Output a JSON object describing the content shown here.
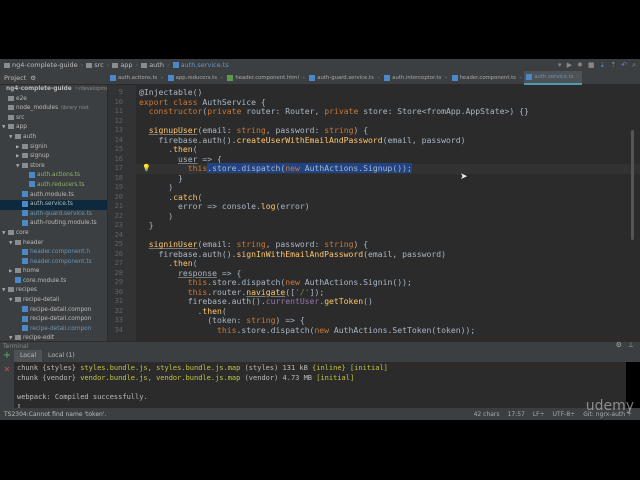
{
  "breadcrumb": [
    "ng4-complete-guide",
    "src",
    "app",
    "auth",
    "auth.service.ts"
  ],
  "project_bar": {
    "label": "Project"
  },
  "tabs": [
    {
      "label": "auth.actions.ts",
      "icon": "ts-file-icon",
      "active": false
    },
    {
      "label": "app.reducers.ts",
      "icon": "ts-file-icon",
      "active": false
    },
    {
      "label": "header.component.html",
      "icon": "html-file-icon",
      "active": false
    },
    {
      "label": "auth-guard.service.ts",
      "icon": "ts-file-icon",
      "active": false
    },
    {
      "label": "auth.interceptor.ts",
      "icon": "ts-file-icon",
      "active": false
    },
    {
      "label": "header.component.ts",
      "icon": "ts-file-icon",
      "active": false
    },
    {
      "label": "auth.service.ts",
      "icon": "ts-file-icon",
      "active": true
    }
  ],
  "tree": [
    {
      "label": "ng4-complete-guide",
      "extra": "~/developmen",
      "level": 0,
      "arrow": "",
      "kind": "root"
    },
    {
      "label": "e2e",
      "level": 0,
      "arrow": "",
      "kind": "folder"
    },
    {
      "label": "node_modules",
      "extra": "library root",
      "level": 0,
      "arrow": "",
      "kind": "folder"
    },
    {
      "label": "src",
      "level": 0,
      "arrow": "",
      "kind": "folder"
    },
    {
      "label": "app",
      "level": 0,
      "arrow": "▼",
      "kind": "folder"
    },
    {
      "label": "auth",
      "level": 1,
      "arrow": "▼",
      "kind": "folder"
    },
    {
      "label": "signin",
      "level": 2,
      "arrow": "▶",
      "kind": "folder"
    },
    {
      "label": "signup",
      "level": 2,
      "arrow": "▶",
      "kind": "folder"
    },
    {
      "label": "store",
      "level": 2,
      "arrow": "▼",
      "kind": "folder"
    },
    {
      "label": "auth.actions.ts",
      "level": 3,
      "kind": "green"
    },
    {
      "label": "auth.reducers.ts",
      "level": 3,
      "kind": "green"
    },
    {
      "label": "auth.module.ts",
      "level": 2,
      "kind": "file"
    },
    {
      "label": "auth.service.ts",
      "level": 2,
      "kind": "file",
      "selected": true
    },
    {
      "label": "auth-guard.service.ts",
      "level": 2,
      "kind": "blue"
    },
    {
      "label": "auth-routing.module.ts",
      "level": 2,
      "kind": "file"
    },
    {
      "label": "core",
      "level": 0,
      "arrow": "▼",
      "kind": "folder"
    },
    {
      "label": "header",
      "level": 1,
      "arrow": "▼",
      "kind": "folder"
    },
    {
      "label": "header.component.h",
      "level": 2,
      "kind": "blue"
    },
    {
      "label": "header.component.ts",
      "level": 2,
      "kind": "blue"
    },
    {
      "label": "home",
      "level": 1,
      "arrow": "▶",
      "kind": "folder"
    },
    {
      "label": "core.module.ts",
      "level": 1,
      "kind": "file"
    },
    {
      "label": "recipes",
      "level": 0,
      "arrow": "▼",
      "kind": "folder"
    },
    {
      "label": "recipe-detail",
      "level": 1,
      "arrow": "▼",
      "kind": "folder"
    },
    {
      "label": "recipe-detail.compon",
      "level": 2,
      "kind": "file"
    },
    {
      "label": "recipe-detail.compon",
      "level": 2,
      "kind": "file"
    },
    {
      "label": "recipe-detail.compon",
      "level": 2,
      "kind": "blue"
    },
    {
      "label": "recipe-edit",
      "level": 1,
      "arrow": "▼",
      "kind": "folder"
    }
  ],
  "code": [
    {
      "n": "9",
      "t": [
        [
          "@Injectable()",
          ""
        ]
      ]
    },
    {
      "n": "10",
      "t": [
        [
          "export class ",
          "kw"
        ],
        [
          "AuthService {",
          ""
        ]
      ]
    },
    {
      "n": "11",
      "t": [
        [
          "  ",
          ""
        ],
        [
          "constructor",
          "kw"
        ],
        [
          "(",
          ""
        ],
        [
          "private",
          "kw"
        ],
        [
          " router: Router, ",
          ""
        ],
        [
          "private",
          "kw"
        ],
        [
          " store: Store<fromApp.AppState>) {}",
          ""
        ]
      ]
    },
    {
      "n": "12",
      "t": []
    },
    {
      "n": "13",
      "t": [
        [
          "  ",
          ""
        ],
        [
          "signupUser",
          "fn ul"
        ],
        [
          "(email: ",
          ""
        ],
        [
          "string",
          "kw"
        ],
        [
          ", password: ",
          ""
        ],
        [
          "string",
          "kw"
        ],
        [
          ") {",
          ""
        ]
      ]
    },
    {
      "n": "14",
      "t": [
        [
          "    firebase.auth().",
          ""
        ],
        [
          "createUserWithEmailAndPassword",
          "fn"
        ],
        [
          "(email, password)",
          ""
        ]
      ]
    },
    {
      "n": "15",
      "t": [
        [
          "      .",
          ""
        ],
        [
          "then",
          "fn"
        ],
        [
          "(",
          ""
        ]
      ]
    },
    {
      "n": "16",
      "t": [
        [
          "        ",
          ""
        ],
        [
          "user",
          "ul"
        ],
        [
          " => {",
          ""
        ]
      ]
    },
    {
      "n": "17",
      "cur": true,
      "t": [
        [
          "          ",
          ""
        ],
        [
          "this",
          "kw"
        ],
        [
          ".store.dispatch(",
          "sel"
        ],
        [
          "new",
          "kw sel"
        ],
        [
          " AuthActions.Signup());",
          "sel"
        ]
      ]
    },
    {
      "n": "18",
      "t": [
        [
          "        }",
          ""
        ]
      ]
    },
    {
      "n": "19",
      "t": [
        [
          "      )",
          ""
        ]
      ]
    },
    {
      "n": "20",
      "t": [
        [
          "      .",
          ""
        ],
        [
          "catch",
          "fn"
        ],
        [
          "(",
          ""
        ]
      ]
    },
    {
      "n": "21",
      "t": [
        [
          "        error => console.",
          ""
        ],
        [
          "log",
          "fn"
        ],
        [
          "(error)",
          ""
        ]
      ]
    },
    {
      "n": "22",
      "t": [
        [
          "      )",
          ""
        ]
      ]
    },
    {
      "n": "23",
      "t": [
        [
          "  }",
          ""
        ]
      ]
    },
    {
      "n": "24",
      "t": []
    },
    {
      "n": "25",
      "t": [
        [
          "  ",
          ""
        ],
        [
          "signinUser",
          "fn ul"
        ],
        [
          "(email: ",
          ""
        ],
        [
          "string",
          "kw"
        ],
        [
          ", password: ",
          ""
        ],
        [
          "string",
          "kw"
        ],
        [
          ") {",
          ""
        ]
      ]
    },
    {
      "n": "26",
      "t": [
        [
          "    firebase.auth().",
          ""
        ],
        [
          "signInWithEmailAndPassword",
          "fn"
        ],
        [
          "(email, password)",
          ""
        ]
      ]
    },
    {
      "n": "27",
      "t": [
        [
          "      .",
          ""
        ],
        [
          "then",
          "fn"
        ],
        [
          "(",
          ""
        ]
      ]
    },
    {
      "n": "28",
      "t": [
        [
          "        ",
          ""
        ],
        [
          "response",
          "ul"
        ],
        [
          " => {",
          ""
        ]
      ]
    },
    {
      "n": "29",
      "t": [
        [
          "          ",
          ""
        ],
        [
          "this",
          "kw"
        ],
        [
          ".store.dispatch(",
          ""
        ],
        [
          "new",
          "kw"
        ],
        [
          " AuthActions.Signin());",
          ""
        ]
      ]
    },
    {
      "n": "30",
      "t": [
        [
          "          ",
          ""
        ],
        [
          "this",
          "kw"
        ],
        [
          ".router.",
          ""
        ],
        [
          "navigate",
          "fn ul"
        ],
        [
          "([",
          ""
        ],
        [
          "'/'",
          "st"
        ],
        [
          "]);",
          ""
        ]
      ]
    },
    {
      "n": "31",
      "t": [
        [
          "          firebase.auth().",
          ""
        ],
        [
          "currentUser",
          "pu"
        ],
        [
          ".",
          ""
        ],
        [
          "getToken",
          "fn"
        ],
        [
          "()",
          ""
        ]
      ]
    },
    {
      "n": "32",
      "t": [
        [
          "            .",
          ""
        ],
        [
          "then",
          "fn"
        ],
        [
          "(",
          ""
        ]
      ]
    },
    {
      "n": "33",
      "t": [
        [
          "              (token: ",
          ""
        ],
        [
          "string",
          "kw"
        ],
        [
          ") => {",
          ""
        ]
      ]
    },
    {
      "n": "34",
      "t": [
        [
          "                ",
          ""
        ],
        [
          "this",
          "kw"
        ],
        [
          ".store.dispatch(",
          ""
        ],
        [
          "new",
          "kw"
        ],
        [
          " AuthActions.SetToken(token));",
          ""
        ]
      ]
    }
  ],
  "terminal": {
    "title": "Terminal",
    "tabs": [
      "Local",
      "Local (1)"
    ],
    "lines": [
      [
        [
          "chunk {styles} ",
          ""
        ],
        [
          "styles.bundle.js, styles.bundle.js.map",
          "yl"
        ],
        [
          " (styles) 131 kB ",
          ""
        ],
        [
          "{inline}",
          "yl"
        ],
        [
          " ",
          ""
        ],
        [
          "[initial]",
          "yl"
        ]
      ],
      [
        [
          "chunk {vendor} ",
          ""
        ],
        [
          "vendor.bundle.js, vendor.bundle.js.map",
          "yl"
        ],
        [
          " (vendor) 4.73 MB ",
          ""
        ],
        [
          "[initial]",
          "yl"
        ]
      ],
      [],
      [
        [
          "webpack: Compiled successfully.",
          ""
        ]
      ],
      [
        [
          "▯",
          ""
        ]
      ]
    ]
  },
  "status": {
    "message": "TS2304:Cannot find name 'token'.",
    "chars": "42 chars",
    "position": "17:57",
    "line_sep": "LF÷",
    "encoding": "UTF-8÷",
    "git": "Git: ngrx-auth ÷"
  },
  "watermark": "udemy"
}
